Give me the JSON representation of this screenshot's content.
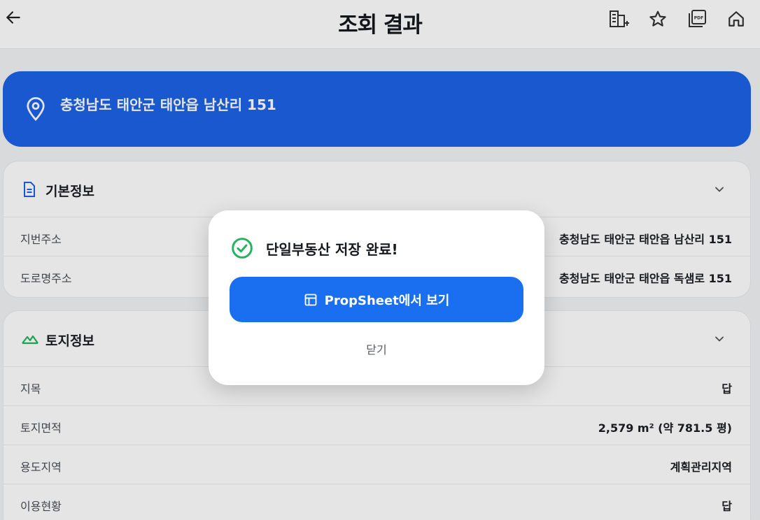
{
  "header": {
    "title": "조회 결과",
    "icons": [
      "arrow-left-icon",
      "building-add-icon",
      "star-icon",
      "pdf-icon",
      "home-icon"
    ]
  },
  "address_banner": {
    "address": "충청남도 태안군 태안읍 남산리 151"
  },
  "basic_info": {
    "title": "기본정보",
    "rows": [
      {
        "label": "지번주소",
        "value": "충청남도 태안군 태안읍 남산리 151"
      },
      {
        "label": "도로명주소",
        "value": "충청남도 태안군 태안읍 독샘로 151"
      }
    ]
  },
  "land_info": {
    "title": "토지정보",
    "rows": [
      {
        "label": "지목",
        "value": "답"
      },
      {
        "label": "토지면적",
        "value": "2,579 m² (약 781.5 평)"
      },
      {
        "label": "용도지역",
        "value": "계획관리지역"
      },
      {
        "label": "이용현황",
        "value": "답"
      }
    ]
  },
  "modal": {
    "title": "단일부동산 저장 완료!",
    "primary_label": "PropSheet에서 보기",
    "close_label": "닫기"
  },
  "colors": {
    "banner": "#1d63e8",
    "primary": "#1a6ff0",
    "success": "#22b45a"
  }
}
